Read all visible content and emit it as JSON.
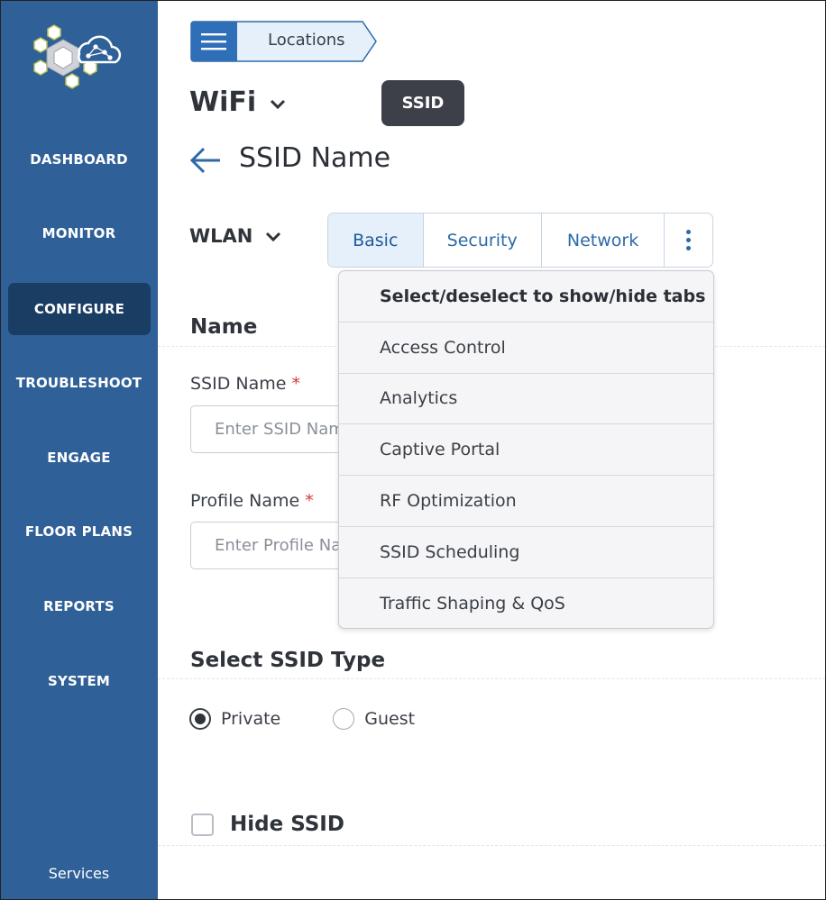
{
  "sidebar": {
    "logo": "hexagon-cloud-logo",
    "items": [
      {
        "label": "DASHBOARD"
      },
      {
        "label": "MONITOR"
      },
      {
        "label": "CONFIGURE",
        "active": true
      },
      {
        "label": "TROUBLESHOOT"
      },
      {
        "label": "ENGAGE"
      },
      {
        "label": "FLOOR PLANS"
      },
      {
        "label": "REPORTS"
      },
      {
        "label": "SYSTEM"
      }
    ],
    "services": "Services"
  },
  "breadcrumb": {
    "menu_icon": "hamburger-icon",
    "label": "Locations"
  },
  "header": {
    "wifi": "WiFi",
    "badge": "SSID",
    "title": "SSID Name"
  },
  "wlan": {
    "label": "WLAN"
  },
  "tabs": [
    {
      "label": "Basic",
      "active": true
    },
    {
      "label": "Security"
    },
    {
      "label": "Network"
    }
  ],
  "dropdown": {
    "header": "Select/deselect to show/hide tabs",
    "items": [
      "Access Control",
      "Analytics",
      "Captive Portal",
      "RF Optimization",
      "SSID Scheduling",
      "Traffic Shaping & QoS"
    ]
  },
  "form": {
    "section_name": "Name",
    "ssid_label": "SSID Name",
    "ssid_placeholder": "Enter SSID Name",
    "profile_label": "Profile Name",
    "profile_placeholder": "Enter Profile Name",
    "required_mark": "*",
    "section_type": "Select SSID Type",
    "options": [
      {
        "label": "Private",
        "selected": true
      },
      {
        "label": "Guest",
        "selected": false
      }
    ],
    "hide_ssid": "Hide SSID"
  },
  "colors": {
    "sidebar": "#2f6098",
    "sidebar_active": "#1a3d64",
    "accent": "#2d6aa8",
    "badge": "#3d4048",
    "required": "#d23a3a"
  }
}
